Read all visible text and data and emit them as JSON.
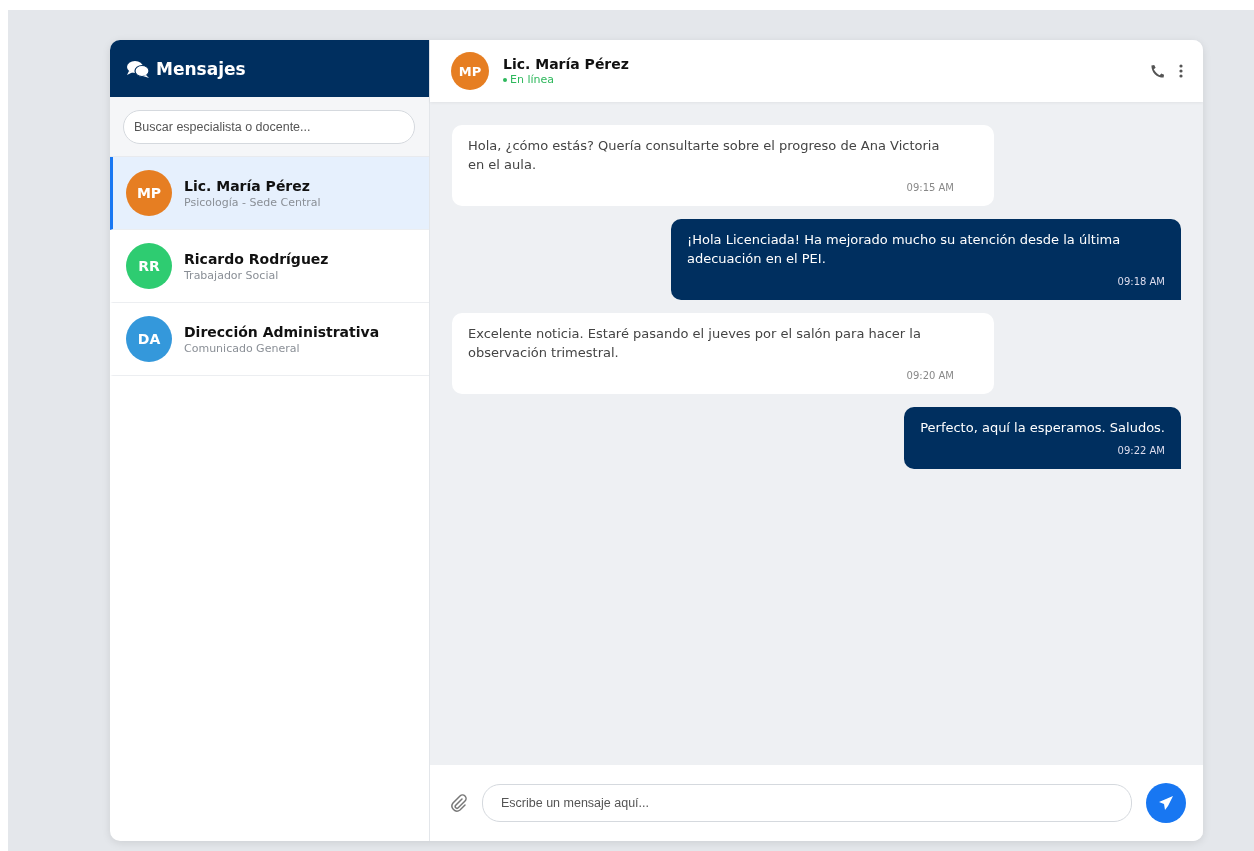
{
  "sidebar": {
    "title": "Mensajes",
    "search": {
      "placeholder": "Buscar especialista o docente..."
    },
    "contacts": [
      {
        "initials": "MP",
        "name": "Lic. María Pérez",
        "role": "Psicología - Sede Central",
        "color": "#e67e22",
        "selected": true
      },
      {
        "initials": "RR",
        "name": "Ricardo Rodríguez",
        "role": "Trabajador Social",
        "color": "#2ecc71",
        "selected": false
      },
      {
        "initials": "DA",
        "name": "Dirección Administrativa",
        "role": "Comunicado General",
        "color": "#3498db",
        "selected": false
      }
    ]
  },
  "chat": {
    "contact": {
      "initials": "MP",
      "name": "Lic. María Pérez",
      "status": "En línea",
      "color": "#e67e22"
    },
    "messages": [
      {
        "kind": "received",
        "text": "Hola, ¿cómo estás? Quería consultarte sobre el progreso de Ana Victoria en el aula.",
        "time": "09:15 AM"
      },
      {
        "kind": "sent",
        "text": "¡Hola Licenciada! Ha mejorado mucho su atención desde la última adecuación en el PEI.",
        "time": "09:18 AM"
      },
      {
        "kind": "received",
        "text": "Excelente noticia. Estaré pasando el jueves por el salón para hacer la observación trimestral.",
        "time": "09:20 AM"
      },
      {
        "kind": "sent",
        "text": "Perfecto, aquí la esperamos. Saludos.",
        "time": "09:22 AM"
      }
    ],
    "composer": {
      "placeholder": "Escribe un mensaje aquí..."
    }
  }
}
